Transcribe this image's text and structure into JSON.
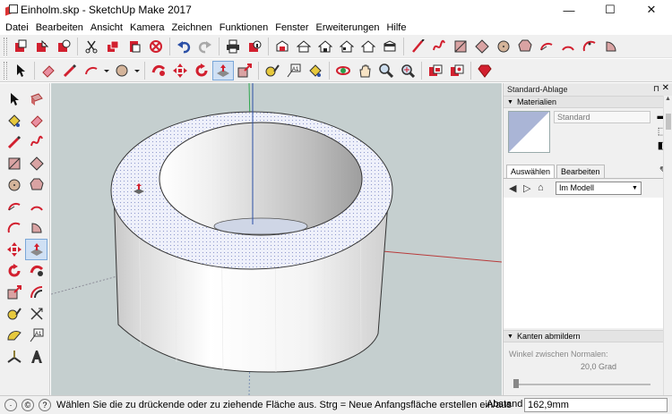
{
  "window": {
    "title": "Einholm.skp - SketchUp Make 2017",
    "minimize": "—",
    "maximize": "☐",
    "close": "✕"
  },
  "menu": [
    {
      "label": "Datei"
    },
    {
      "label": "Bearbeiten"
    },
    {
      "label": "Ansicht"
    },
    {
      "label": "Kamera"
    },
    {
      "label": "Zeichnen"
    },
    {
      "label": "Funktionen"
    },
    {
      "label": "Fenster"
    },
    {
      "label": "Erweiterungen"
    },
    {
      "label": "Hilfe"
    }
  ],
  "toolbar1": [
    "new-file-icon",
    "open-file-icon",
    "save-icon",
    "cut-icon",
    "copy-icon",
    "paste-icon",
    "erase-icon",
    "undo-icon",
    "redo-icon",
    "print-icon",
    "model-info-icon",
    "iso-view-icon",
    "top-view-icon",
    "front-view-icon",
    "right-view-icon",
    "back-view-icon",
    "left-view-icon",
    "line-icon",
    "freehand-icon",
    "rectangle-icon",
    "rotated-rectangle-icon",
    "circle-icon",
    "polygon-icon",
    "arc-icon",
    "two-point-arc-icon",
    "three-point-arc-icon",
    "pie-icon"
  ],
  "toolbar2": [
    "select-icon",
    "eraser-icon",
    "pencil-icon",
    "arc-dropdown-icon",
    "circle-dropdown-icon",
    "follow-me-icon",
    "move-icon",
    "rotate-icon",
    "push-pull-icon",
    "scale-icon",
    "tape-icon",
    "text-icon",
    "paint-icon",
    "orbit-icon",
    "pan-icon",
    "zoom-icon",
    "zoom-extents-icon",
    "warehouse-icon",
    "extension-icon",
    "ruby-icon"
  ],
  "lefttools": [
    "select-icon",
    "component-icon",
    "paint-icon",
    "eraser-icon",
    "pencil-icon",
    "freehand-icon",
    "rectangle-icon",
    "rotated-rectangle-icon",
    "circle-icon",
    "polygon-icon",
    "arc-icon",
    "two-point-arc-icon",
    "three-point-arc-icon",
    "pie-icon",
    "move-icon",
    "push-pull-icon",
    "rotate-icon",
    "follow-me-icon",
    "scale-icon",
    "offset-icon",
    "tape-icon",
    "dimension-icon",
    "protractor-icon",
    "text-icon",
    "axes-icon",
    "3d-text-icon"
  ],
  "tray": {
    "title": "Standard-Ablage",
    "pin": "⊓",
    "close": "✕",
    "materials": {
      "header": "Materialien",
      "name_value": "Standard",
      "tab_select": "Auswählen",
      "tab_edit": "Bearbeiten",
      "dropdown": "Im Modell"
    },
    "soften": {
      "header": "Kanten abmildern",
      "angle_label": "Winkel zwischen Normalen:",
      "angle_value": "20,0  Grad"
    }
  },
  "status": {
    "message": "Wählen Sie die zu drückende oder zu ziehende Fläche aus.  Strg = Neue Anfangsfläche erstellen ein/aus",
    "measure_label": "Abstand",
    "measure_value": "162,9mm"
  },
  "colors": {
    "sky": "#c5cfcf",
    "face_top": "#b4bfe0",
    "red": "#d2202f",
    "accent_blue": "#2b4fa6"
  }
}
